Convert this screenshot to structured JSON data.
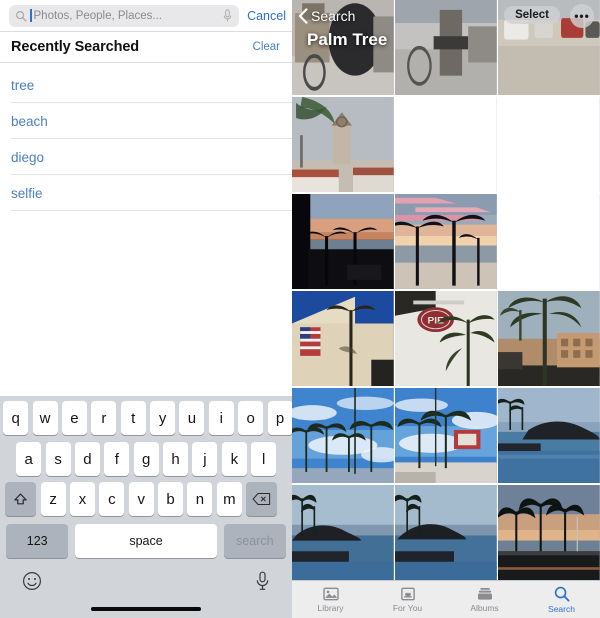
{
  "left": {
    "search": {
      "placeholder": "Photos, People, Places...",
      "value": "",
      "search_icon": "search-icon",
      "mic_icon": "microphone-icon",
      "cancel_label": "Cancel"
    },
    "recent": {
      "title": "Recently Searched",
      "clear_label": "Clear",
      "items": [
        {
          "label": "tree"
        },
        {
          "label": "beach"
        },
        {
          "label": "diego"
        },
        {
          "label": "selfie"
        }
      ]
    },
    "keyboard": {
      "row1": [
        "q",
        "w",
        "e",
        "r",
        "t",
        "y",
        "u",
        "i",
        "o",
        "p"
      ],
      "row2": [
        "a",
        "s",
        "d",
        "f",
        "g",
        "h",
        "j",
        "k",
        "l"
      ],
      "row3": [
        "z",
        "x",
        "c",
        "v",
        "b",
        "n",
        "m"
      ],
      "shift_icon": "shift-arrow-icon",
      "delete_icon": "backspace-icon",
      "numbers_label": "123",
      "space_label": "space",
      "search_label": "search",
      "emoji_icon": "emoji-smiley-icon",
      "dictation_icon": "microphone-icon"
    }
  },
  "right": {
    "header": {
      "back_label": "Search",
      "back_icon": "chevron-left-icon",
      "title": "Palm Tree",
      "select_label": "Select",
      "more_label": "•••",
      "more_icon": "ellipsis-icon"
    },
    "grid": {
      "columns": 3,
      "cells": [
        {
          "name": "photo-bicycle-cart",
          "kind": "photo",
          "theme": "street-gray"
        },
        {
          "name": "photo-bike-trailer",
          "kind": "photo",
          "theme": "street-gray"
        },
        {
          "name": "photo-parking-lot",
          "kind": "photo",
          "theme": "street-gray"
        },
        {
          "name": "photo-church-tower",
          "kind": "photo",
          "theme": "town-overcast"
        },
        {
          "name": "photo-placeholder-1",
          "kind": "placeholder",
          "theme": "blank"
        },
        {
          "name": "photo-placeholder-2",
          "kind": "placeholder",
          "theme": "blank"
        },
        {
          "name": "photo-sunset-palms-dark",
          "kind": "photo",
          "theme": "sunset-dark"
        },
        {
          "name": "photo-sunset-beach-palms",
          "kind": "photo",
          "theme": "sunset-pink"
        },
        {
          "name": "photo-placeholder-3",
          "kind": "placeholder",
          "theme": "blank"
        },
        {
          "name": "photo-flag-building-palm",
          "kind": "photo",
          "theme": "blue-sky-building"
        },
        {
          "name": "photo-pie-sign-palm",
          "kind": "photo",
          "theme": "pie-sign"
        },
        {
          "name": "photo-palm-resort",
          "kind": "photo",
          "theme": "resort-palms"
        },
        {
          "name": "photo-palms-clouds-1",
          "kind": "photo",
          "theme": "blue-sky-palms"
        },
        {
          "name": "photo-palms-clouds-2",
          "kind": "photo",
          "theme": "blue-sky-palms"
        },
        {
          "name": "photo-coast-rocks-1",
          "kind": "photo",
          "theme": "ocean-rocks"
        },
        {
          "name": "photo-coast-rocks-2",
          "kind": "photo",
          "theme": "ocean-rocks"
        },
        {
          "name": "photo-coast-rocks-3",
          "kind": "photo",
          "theme": "ocean-rocks"
        },
        {
          "name": "photo-dusk-palm-road",
          "kind": "photo",
          "theme": "dusk-road"
        }
      ]
    },
    "tabs": [
      {
        "label": "Library",
        "icon": "photos-library-icon",
        "active": false
      },
      {
        "label": "For You",
        "icon": "for-you-heart-icon",
        "active": false
      },
      {
        "label": "Albums",
        "icon": "albums-stack-icon",
        "active": false
      },
      {
        "label": "Search",
        "icon": "search-icon",
        "active": true
      }
    ]
  },
  "colors": {
    "accent": "#2f6fd0",
    "link": "#4a7fc1",
    "keyboard_bg": "#d1d4d9",
    "key_bg": "#ffffff",
    "key_dark": "#adb3bd",
    "tab_inactive": "#8c8c90"
  }
}
